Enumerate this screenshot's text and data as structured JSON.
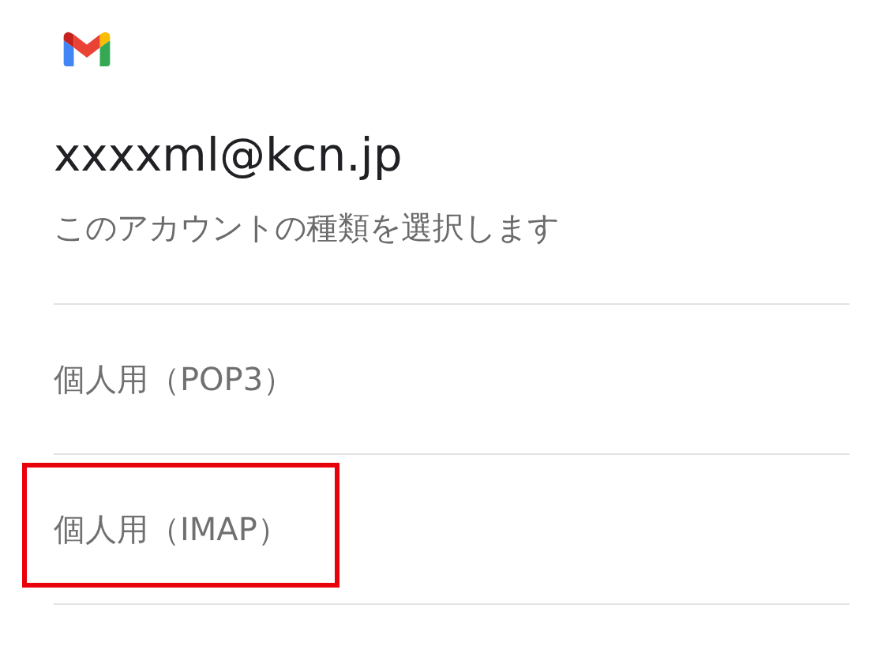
{
  "header": {
    "email": "xxxxml@kcn.jp",
    "subtitle": "このアカウントの種類を選択します"
  },
  "options": [
    {
      "label": "個人用（POP3）",
      "highlighted": false
    },
    {
      "label": "個人用（IMAP）",
      "highlighted": true
    }
  ]
}
